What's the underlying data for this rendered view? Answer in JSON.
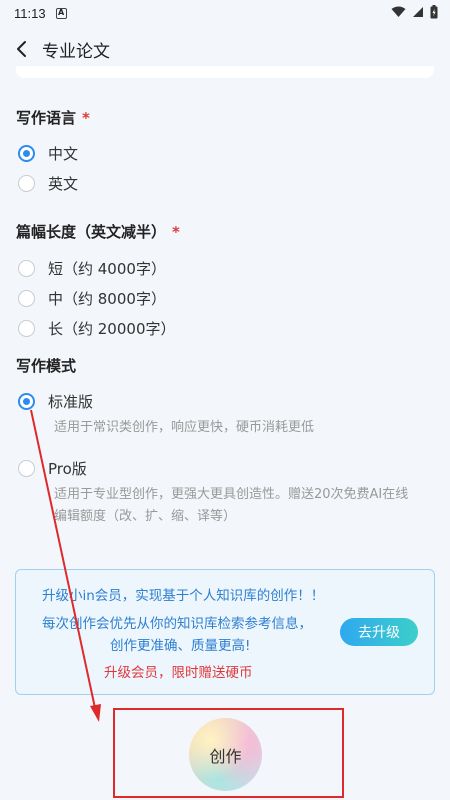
{
  "status_bar": {
    "time": "11:13",
    "app_icon_letter": "A"
  },
  "header": {
    "title": "专业论文"
  },
  "language": {
    "label": "写作语言",
    "required_mark": "*",
    "options": [
      {
        "label": "中文",
        "checked": true
      },
      {
        "label": "英文",
        "checked": false
      }
    ]
  },
  "length": {
    "label": "篇幅长度（英文减半）",
    "required_mark": "*",
    "options": [
      {
        "label": "短（约 4000字）",
        "checked": false
      },
      {
        "label": "中（约 8000字）",
        "checked": false
      },
      {
        "label": "长（约 20000字）",
        "checked": false
      }
    ]
  },
  "mode": {
    "label": "写作模式",
    "options": [
      {
        "label": "标准版",
        "checked": true,
        "desc": "适用于常识类创作，响应更快，硬币消耗更低"
      },
      {
        "label": "Pro版",
        "checked": false,
        "desc_line1": "适用于专业型创作，更强大更具创造性。赠送20次免费AI在线",
        "desc_line2": "编辑额度（改、扩、缩、译等）"
      }
    ]
  },
  "upgrade": {
    "line1": "升级小in会员，实现基于个人知识库的创作！！",
    "line2": "每次创作会优先从你的知识库检索参考信息，",
    "line3": "创作更准确、质量更高!",
    "promo": "升级会员，限时赠送硬币",
    "button": "去升级"
  },
  "create_button": "创作",
  "colors": {
    "accent": "#2d8cf0",
    "required": "#e03a3a",
    "annotation": "#e0292b",
    "panel_text": "#2c7fd0"
  }
}
